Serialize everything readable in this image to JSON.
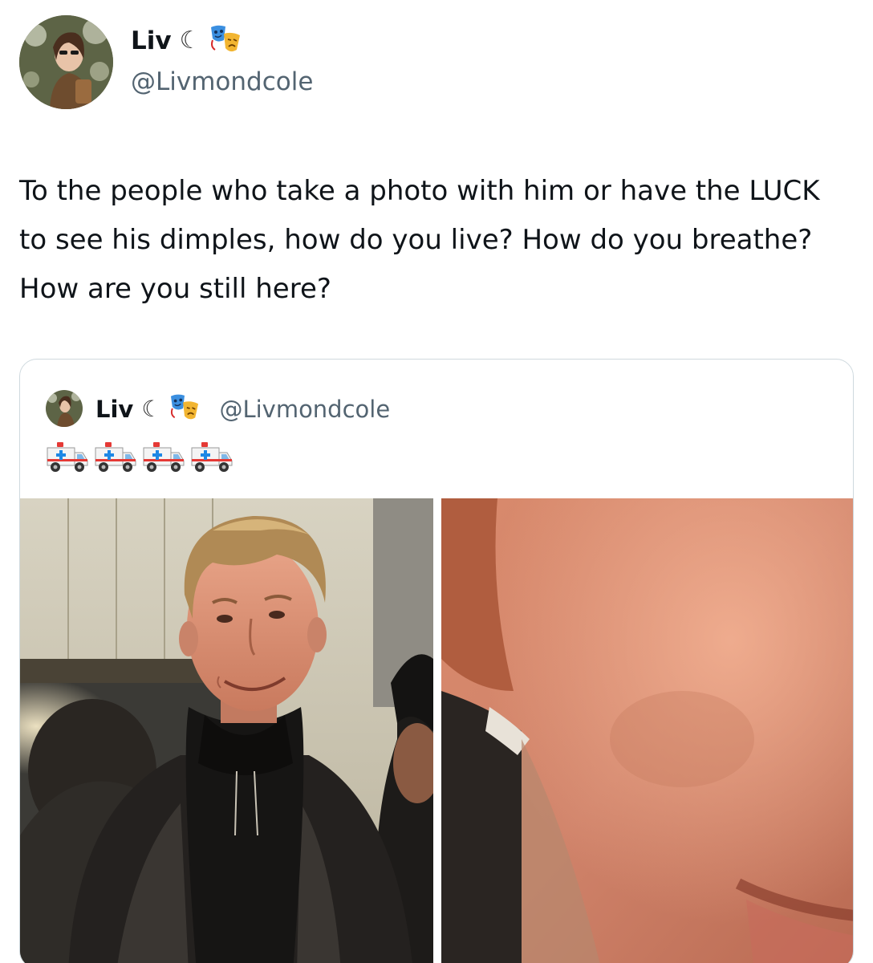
{
  "author": {
    "display_name": "Liv",
    "moon_glyph": "☾",
    "theater_icon": "performing-arts-icon",
    "handle": "@Livmondcole"
  },
  "tweet": {
    "text": "To the people who take a photo with him or have the LUCK to see his dimples, how do you live? How do you breathe? How are you still here?"
  },
  "quoted_tweet": {
    "display_name": "Liv",
    "moon_glyph": "☾",
    "theater_icon": "performing-arts-icon",
    "handle": "@Livmondcole",
    "emojis": [
      "ambulance-icon",
      "ambulance-icon",
      "ambulance-icon",
      "ambulance-icon"
    ],
    "media": [
      "photo-smiling-man",
      "photo-dimple-closeup"
    ]
  },
  "colors": {
    "text_primary": "#0f1419",
    "text_secondary": "#536471",
    "border": "#cfd9de"
  }
}
